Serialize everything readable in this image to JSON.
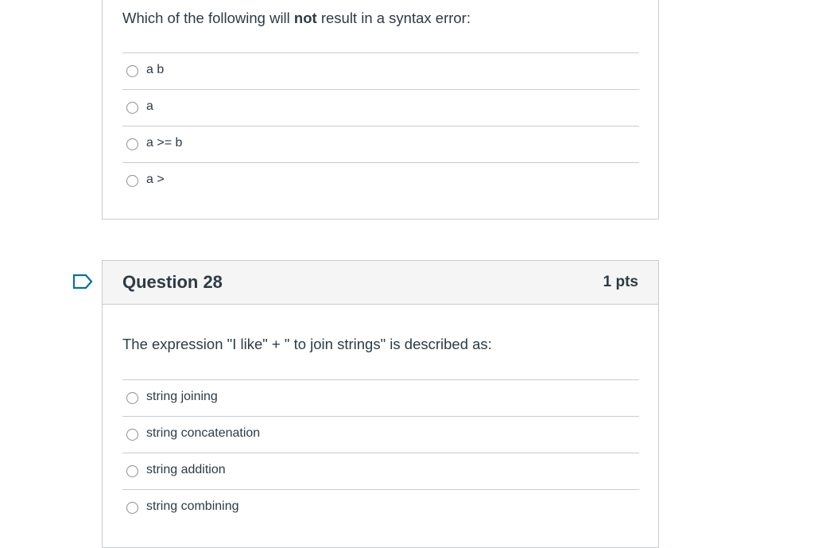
{
  "question27": {
    "text_before": "Which of the following will ",
    "text_bold": "not",
    "text_after": " result in a syntax error:",
    "answers": [
      "a b",
      "a",
      "a >= b",
      "a >"
    ]
  },
  "question28": {
    "title": "Question 28",
    "points": "1 pts",
    "text": "The expression \"I like\" + \" to join strings\" is described as:",
    "answers": [
      "string joining",
      "string concatenation",
      "string addition",
      "string combining"
    ]
  },
  "icons": {
    "flag": "flag-question-icon"
  },
  "colors": {
    "accent": "#0770a3",
    "border": "#c7cdd1",
    "header_bg": "#f5f5f5",
    "text": "#2d3b45"
  }
}
